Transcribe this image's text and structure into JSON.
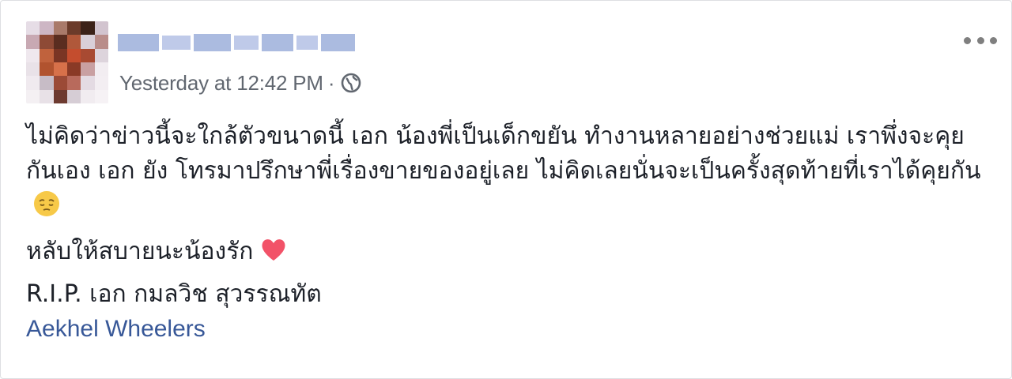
{
  "post": {
    "author": {
      "name": "",
      "avatar_icon": "avatar-blurred"
    },
    "timestamp": "Yesterday at 12:42 PM",
    "separator": "·",
    "privacy_icon": "globe-icon",
    "menu_icon": "more-options-icon",
    "paragraphs": [
      "ไม่คิดว่าข่าวนี้จะใกล้ตัวขนาดนี้ เอก น้องพี่เป็นเด็กขยัน ทำงานหลายอย่างช่วยแม่ เราพึ่งจะคุยกันเอง เอก ยัง โทรมาปรึกษาพี่เรื่องขายของอยู่เลย ไม่คิดเลยนั่นจะเป็นครั้งสุดท้ายที่เราได้คุยกัน",
      "หลับให้สบายนะน้องรัก",
      "R.I.P. เอก กมลวิช สุวรรณทัต"
    ],
    "emojis": [
      "pensive-face",
      "red-heart"
    ],
    "tag": "Aekhel Wheelers"
  },
  "colors": {
    "meta_text": "#616770",
    "body_text": "#1d2129",
    "link": "#385898",
    "heart": "#f25268",
    "emoji_face": "#f7c948"
  }
}
